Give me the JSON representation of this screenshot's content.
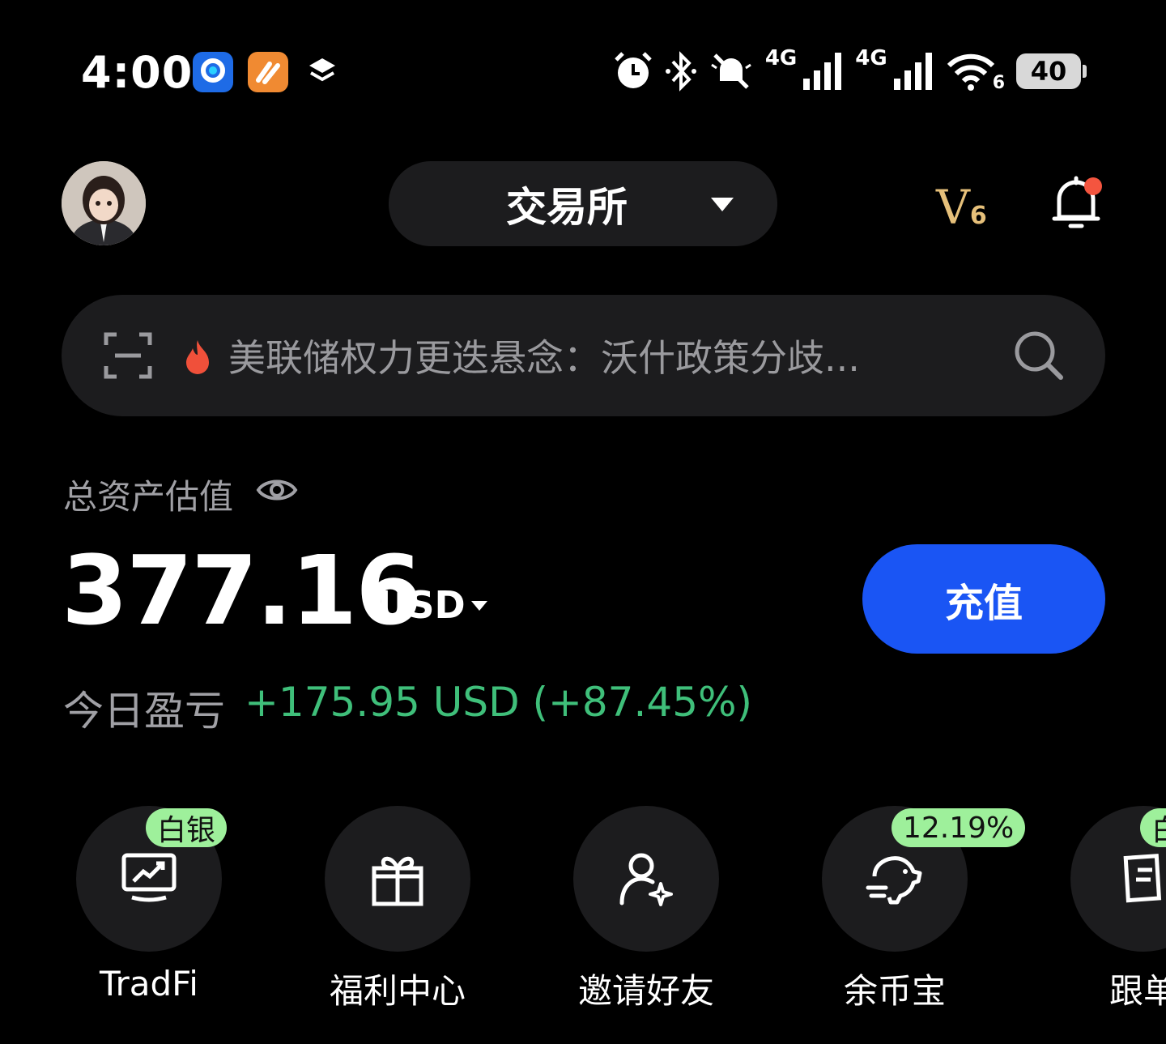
{
  "status_bar": {
    "time": "4:00",
    "network_1": "4G",
    "network_2": "4G",
    "wifi_sub": "6",
    "battery": "40",
    "icons": [
      "app-icon-blue",
      "app-icon-orange",
      "layers-icon",
      "alarm-icon",
      "bluetooth-icon",
      "mute-icon",
      "signal-icon",
      "signal-icon",
      "wifi-icon",
      "battery-icon"
    ]
  },
  "header": {
    "exchange_label": "交易所",
    "vip_level": "V",
    "vip_number": "6",
    "notification_dot": true
  },
  "search": {
    "hot_text": "美联储权力更迭悬念：沃什政策分歧..."
  },
  "assets": {
    "label": "总资产估值",
    "amount": "377.16",
    "currency": "USD",
    "deposit_label": "充值",
    "pnl_label": "今日盈亏",
    "pnl_value": "+175.95 USD (+87.45%)"
  },
  "quick_items": [
    {
      "label": "TradFi",
      "badge": "白银"
    },
    {
      "label": "福利中心",
      "badge": ""
    },
    {
      "label": "邀请好友",
      "badge": ""
    },
    {
      "label": "余币宝",
      "badge": "12.19%"
    },
    {
      "label": "跟单",
      "badge": "白"
    }
  ],
  "colors": {
    "background": "#000000",
    "card": "#1c1c1e",
    "primary_button": "#1a55f4",
    "profit_green": "#3fbf7a",
    "badge_green": "#9ef09b",
    "vip_gold": "#e6c07a",
    "notification_red": "#f4553f"
  }
}
